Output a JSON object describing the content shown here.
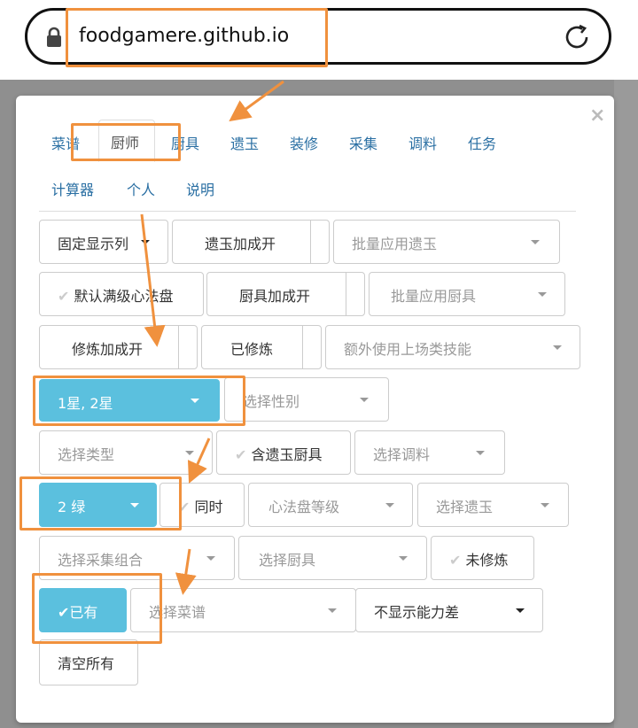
{
  "browser": {
    "url": "foodgamere.github.io"
  },
  "tabs_row1": [
    "菜谱",
    "厨师",
    "厨具",
    "遗玉",
    "装修",
    "采集",
    "调料",
    "任务"
  ],
  "tabs_row2": [
    "计算器",
    "个人",
    "说明"
  ],
  "controls": {
    "fixed_columns": "固定显示列",
    "jade_bonus": "遗玉加成开",
    "batch_jade": "批量应用遗玉",
    "default_full_level": "默认满级心法盘",
    "tool_bonus": "厨具加成开",
    "batch_tool": "批量应用厨具",
    "cultivate_bonus": "修炼加成开",
    "cultivated": "已修炼",
    "extra_skill": "额外使用上场类技能",
    "stars": "1星, 2星",
    "gender": "选择性别",
    "type": "选择类型",
    "with_jade_tools": "含遗玉厨具",
    "seasoning": "选择调料",
    "green": "2 绿",
    "simultaneous": "同时",
    "heart_level": "心法盘等级",
    "select_jade": "选择遗玉",
    "collect_combo": "选择采集组合",
    "select_tool": "选择厨具",
    "not_cultivated": "未修炼",
    "owned": "已有",
    "select_recipe": "选择菜谱",
    "hide_diff": "不显示能力差",
    "clear_all": "清空所有"
  },
  "colors": {
    "accent": "#5bc0de",
    "annotation": "#f0913e",
    "link": "#2a6fa3"
  }
}
